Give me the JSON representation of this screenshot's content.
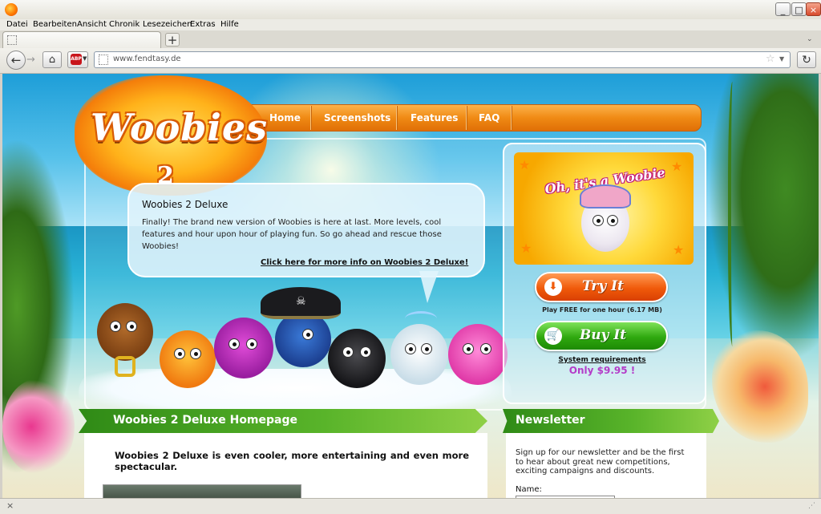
{
  "browser": {
    "menu": [
      "Datei",
      "Bearbeiten",
      "Ansicht",
      "Chronik",
      "Lesezeichen",
      "Extras",
      "Hilfe"
    ],
    "tab_title": "",
    "new_tab_label": "+",
    "back_glyph": "←",
    "forward_glyph": "→",
    "home_glyph": "⌂",
    "adblock_label": "ABP",
    "url": "www.fendtasy.de",
    "star_glyph": "☆",
    "reload_glyph": "↻",
    "tab_list_glyph": "⌄",
    "window_buttons": {
      "minimize": "_",
      "maximize": "□",
      "close": "×"
    },
    "status_close_glyph": "×",
    "icons": [
      "firefox-logo-icon",
      "back-arrow-icon",
      "forward-arrow-icon",
      "home-icon",
      "adblock-icon",
      "page-icon",
      "star-icon",
      "reload-icon"
    ]
  },
  "site": {
    "logo": {
      "word": "Woobies",
      "number": "2"
    },
    "nav": [
      "Home",
      "Screenshots",
      "Features",
      "FAQ"
    ],
    "bubble": {
      "title": "Woobies 2 Deluxe",
      "text": "Finally! The brand new version of Woobies is here at last. More levels, cool features and hour upon hour of playing fun. So go ahead and rescue those Woobies!",
      "link": "Click here for more info on Woobies 2 Deluxe!"
    },
    "promo": {
      "caption": "Oh, it's a Woobie",
      "try_label": "Try It",
      "try_note": "Play FREE for one hour (6.17 MB)",
      "buy_label": "Buy It",
      "sysreq_link": "System requirements",
      "price": "Only $9.95 !"
    },
    "main_section": {
      "title": "Woobies 2 Deluxe Homepage",
      "lead": "Woobies 2 Deluxe is even cooler, more entertaining and even more spectacular."
    },
    "newsletter": {
      "title": "Newsletter",
      "text": "Sign up for our newsletter and be the first to hear about great new competitions, exciting campaigns and discounts.",
      "name_label": "Name:",
      "name_value": ""
    },
    "colors": {
      "nav_orange": "#f08a14",
      "banner_green": "#2f8a16",
      "try_orange": "#f05a0a",
      "buy_green": "#2fa80f",
      "price_purple": "#b43cc8"
    }
  }
}
